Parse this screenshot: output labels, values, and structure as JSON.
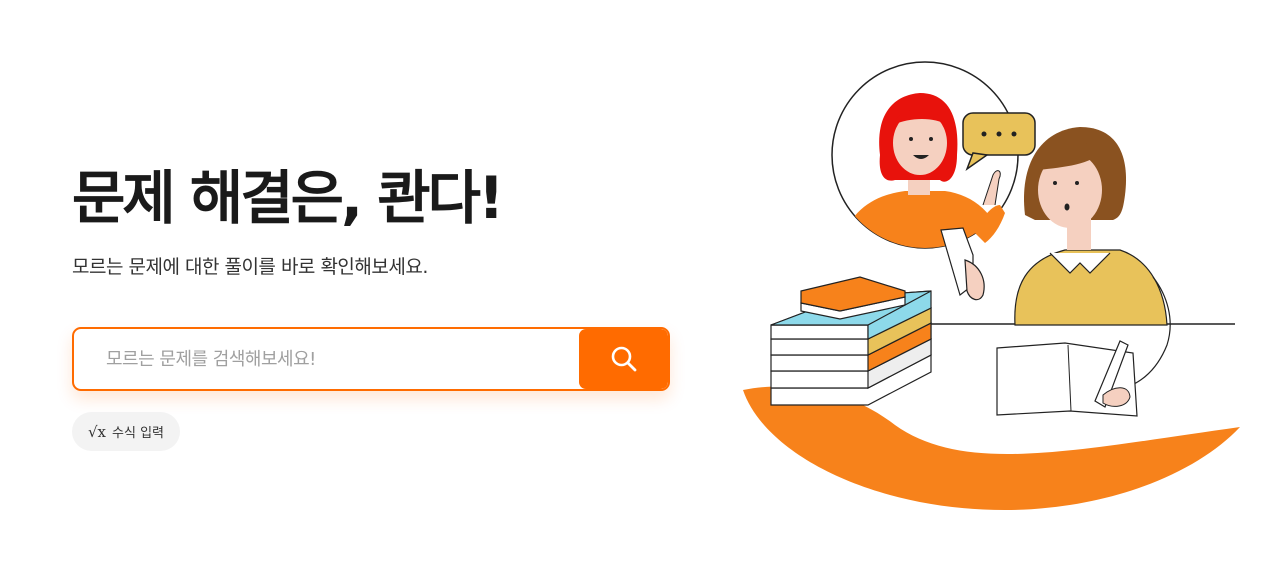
{
  "hero": {
    "title": "문제 해결은, 콴다!",
    "subtitle": "모르는 문제에 대한 풀이를 바로 확인해보세요."
  },
  "search": {
    "placeholder": "모르는 문제를 검색해보세요!",
    "button_icon": "search-icon"
  },
  "formula_input": {
    "icon_symbol": "√x",
    "label": "수식 입력"
  },
  "colors": {
    "accent": "#ff6b00",
    "wave": "#f7821b",
    "sweater": "#e8c25a",
    "book_blue": "#8dd9ea",
    "hair_red": "#e8120c",
    "hair_brown": "#8a5220"
  }
}
